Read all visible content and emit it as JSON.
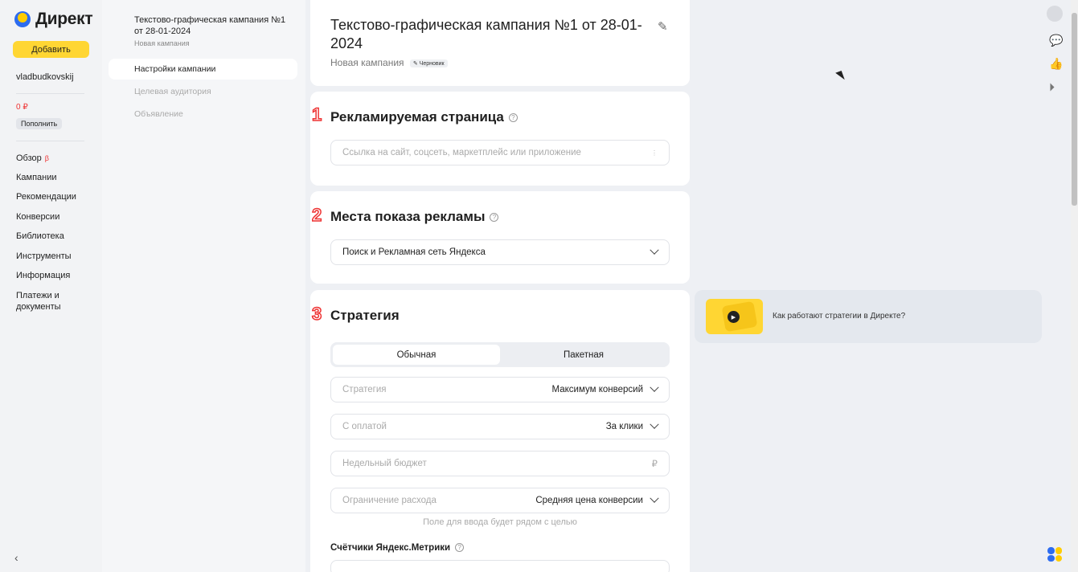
{
  "left_nav": {
    "logo": "Директ",
    "add_button": "Добавить",
    "username": "vladbudkovskij",
    "balance": "0 ₽",
    "topup": "Пополнить",
    "items": [
      "Обзор",
      "Кампании",
      "Рекомендации",
      "Конверсии",
      "Библиотека",
      "Инструменты",
      "Информация",
      "Платежи и документы"
    ],
    "beta": "β"
  },
  "campaign_nav": {
    "title": "Текстово-графическая кампания №1 от 28-01-2024",
    "subtitle": "Новая кампания",
    "menu": [
      "Настройки кампании",
      "Целевая аудитория",
      "Объявление"
    ]
  },
  "header_card": {
    "title": "Текстово-графическая кампания №1 от 28-01-2024",
    "subtitle": "Новая кампания",
    "badge": "✎ Черновик"
  },
  "page_section": {
    "step": "1",
    "title": "Рекламируемая страница",
    "placeholder": "Ссылка на сайт, соцсеть, маркетплейс или приложение"
  },
  "placement_section": {
    "step": "2",
    "title": "Места показа рекламы",
    "value": "Поиск и Рекламная сеть Яндекса"
  },
  "strategy_section": {
    "step": "3",
    "title": "Стратегия",
    "tabs": [
      "Обычная",
      "Пакетная"
    ],
    "strategy_label": "Стратегия",
    "strategy_value": "Максимум конверсий",
    "payment_label": "С оплатой",
    "payment_value": "За клики",
    "budget_label": "Недельный бюджет",
    "currency": "₽",
    "limit_label": "Ограничение расхода",
    "limit_value": "Средняя цена конверсии",
    "hint": "Поле для ввода будет рядом с целью",
    "metrika_title": "Счётчики Яндекс.Метрики"
  },
  "promo": {
    "text": "Как работают стратегии в Директе?"
  },
  "colors": {
    "accent_yellow": "#ffd633",
    "step_red": "#ee3333"
  }
}
